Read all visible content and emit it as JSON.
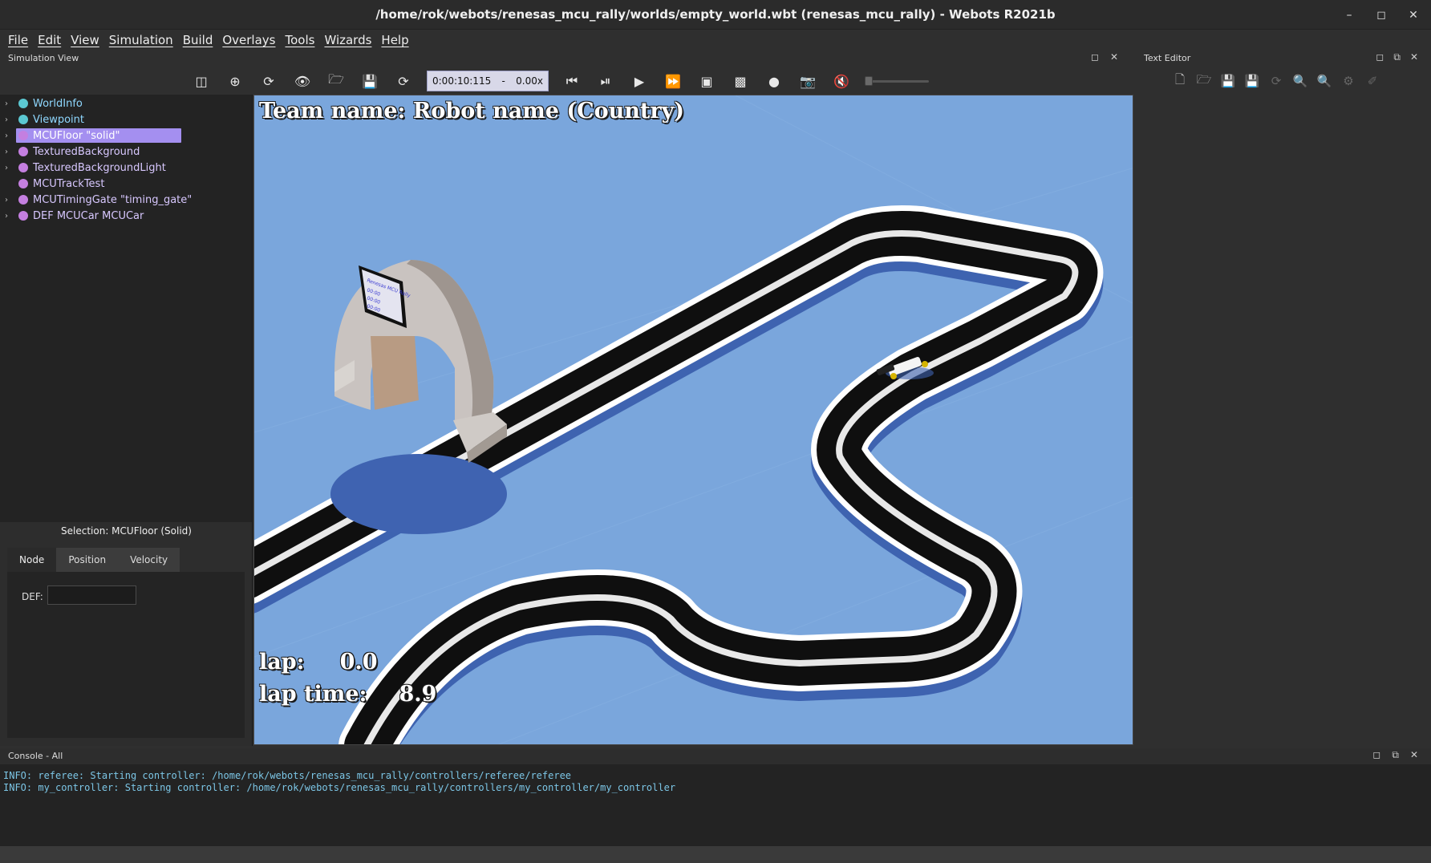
{
  "window": {
    "title": "/home/rok/webots/renesas_mcu_rally/worlds/empty_world.wbt (renesas_mcu_rally) - Webots R2021b"
  },
  "menubar": [
    "File",
    "Edit",
    "View",
    "Simulation",
    "Build",
    "Overlays",
    "Tools",
    "Wizards",
    "Help"
  ],
  "simulation_view": {
    "label": "Simulation View",
    "time": "0:00:10:115",
    "speed": "0.00x"
  },
  "scene_tree": {
    "items": [
      {
        "label": "WorldInfo",
        "color": "#5bc8d2",
        "has_arrow": true,
        "selected": false
      },
      {
        "label": "Viewpoint",
        "color": "#5bc8d2",
        "has_arrow": true,
        "selected": false
      },
      {
        "label": "MCUFloor \"solid\"",
        "color": "#c47fe0",
        "has_arrow": true,
        "selected": true
      },
      {
        "label": "TexturedBackground",
        "color": "#c47fe0",
        "has_arrow": true,
        "selected": false
      },
      {
        "label": "TexturedBackgroundLight",
        "color": "#c47fe0",
        "has_arrow": true,
        "selected": false
      },
      {
        "label": "MCUTrackTest",
        "color": "#c47fe0",
        "has_arrow": false,
        "selected": false
      },
      {
        "label": "MCUTimingGate \"timing_gate\"",
        "color": "#c47fe0",
        "has_arrow": true,
        "selected": false
      },
      {
        "label": "DEF MCUCar MCUCar",
        "color": "#c47fe0",
        "has_arrow": true,
        "selected": false
      }
    ]
  },
  "selection": {
    "title": "Selection: MCUFloor (Solid)",
    "tabs": [
      "Node",
      "Position",
      "Velocity"
    ],
    "def_label": "DEF:",
    "def_value": ""
  },
  "overlay": {
    "team_name": "Team name: Robot name (Country)",
    "lap_label": "lap:",
    "lap_value": "0.0",
    "lap_time_label": "lap time:",
    "lap_time_value": "8.9"
  },
  "text_editor": {
    "label": "Text Editor"
  },
  "console": {
    "label": "Console - All",
    "lines": [
      "INFO: referee: Starting controller: /home/rok/webots/renesas_mcu_rally/controllers/referee/referee",
      "INFO: my_controller: Starting controller: /home/rok/webots/renesas_mcu_rally/controllers/my_controller/my_controller"
    ]
  },
  "colors": {
    "selection": "#a48ff0",
    "sky_floor": "#7aa6dc",
    "console_text": "#7cc6e6"
  }
}
